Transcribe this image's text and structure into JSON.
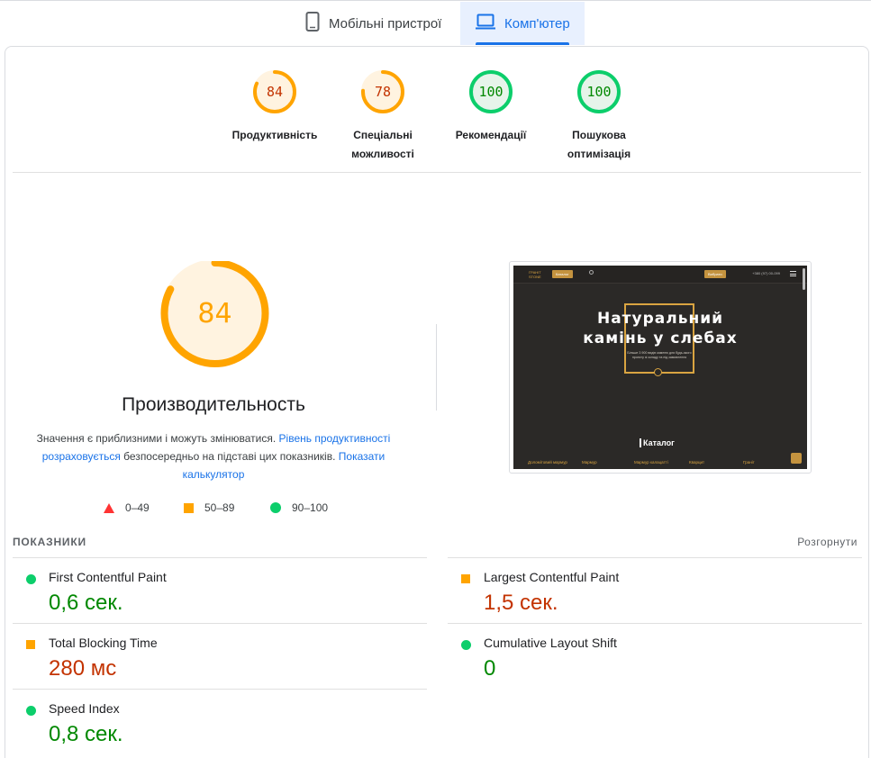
{
  "tabs": {
    "mobile_label": "Мобільні пристрої",
    "desktop_label": "Комп'ютер",
    "mobile_icon": "smartphone-icon",
    "desktop_icon": "laptop-icon",
    "active": "desktop"
  },
  "colors": {
    "average": "#ffa400",
    "pass": "#0cce6b",
    "fail": "#ff3333",
    "accent": "#1a73e8"
  },
  "categories": [
    {
      "score": "84",
      "label": "Продуктивність",
      "value": 84,
      "status": "average"
    },
    {
      "score": "78",
      "label": "Спеціальні можливості",
      "value": 78,
      "status": "average"
    },
    {
      "score": "100",
      "label": "Рекомендації",
      "value": 100,
      "status": "pass"
    },
    {
      "score": "100",
      "label": "Пошукова оптимізація",
      "value": 100,
      "status": "pass"
    }
  ],
  "performance": {
    "score": "84",
    "value": 84,
    "title": "Производительность",
    "desc_prefix": "Значення є приблизними і можуть змінюватися. ",
    "desc_link1": "Рівень продуктивності розраховується",
    "desc_middle": " безпосередньо на підставі цих показників. ",
    "desc_link2": "Показати калькулятор"
  },
  "legend": [
    {
      "range": "0–49",
      "shape": "triangle"
    },
    {
      "range": "50–89",
      "shape": "square"
    },
    {
      "range": "90–100",
      "shape": "circle"
    }
  ],
  "screenshot": {
    "logo": "ГРАНІТ STONE",
    "catalog_button": "Каталог",
    "order_button": "Вибрати",
    "phone": "+380 (97) 00-099",
    "headline_line1": "Натуральний",
    "headline_line2": "камінь у слебах",
    "subtext": "Більше 3 900 видів каменю для будь-якого проекту зі складу та під замовлення",
    "catalog_heading": "Каталог",
    "category_items": [
      "Доломітовий мармур",
      "Мармур",
      "Мармур калацатті",
      "Кварцит",
      "Граніт"
    ]
  },
  "metrics": {
    "title": "ПОКАЗНИКИ",
    "expand_label": "Розгорнути",
    "items": [
      {
        "name": "First Contentful Paint",
        "value": "0,6 сек.",
        "status": "pass"
      },
      {
        "name": "Largest Contentful Paint",
        "value": "1,5 сек.",
        "status": "average"
      },
      {
        "name": "Total Blocking Time",
        "value": "280 мс",
        "status": "average"
      },
      {
        "name": "Cumulative Layout Shift",
        "value": "0",
        "status": "pass"
      },
      {
        "name": "Speed Index",
        "value": "0,8 сек.",
        "status": "pass"
      }
    ]
  }
}
